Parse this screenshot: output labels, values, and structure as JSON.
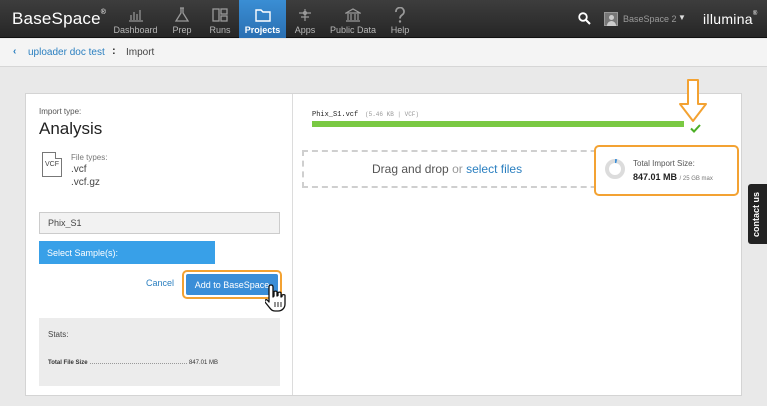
{
  "app": {
    "brand": "BaseSpace",
    "brand_mark": "®",
    "vendor": "illumina",
    "vendor_mark": "®"
  },
  "nav": [
    {
      "label": "Dashboard",
      "icon": "dashboard-icon"
    },
    {
      "label": "Prep",
      "icon": "flask-icon"
    },
    {
      "label": "Runs",
      "icon": "runs-icon"
    },
    {
      "label": "Projects",
      "icon": "folder-icon",
      "active": true
    },
    {
      "label": "Apps",
      "icon": "apps-icon"
    },
    {
      "label": "Public Data",
      "icon": "building-icon"
    },
    {
      "label": "Help",
      "icon": "help-icon"
    }
  ],
  "user": {
    "name": "BaseSpace 2",
    "caret": "▼"
  },
  "breadcrumb": {
    "back": "‹",
    "project": "uploader doc test",
    "separator": ":",
    "current": "Import"
  },
  "import": {
    "type_label": "Import type:",
    "type_value": "Analysis",
    "file_icon_text": "VCF",
    "file_types_label": "File types:",
    "file_types": [
      ".vcf",
      ".vcf.gz"
    ],
    "sample_name": "Phix_S1",
    "select_samples_label": "Select Sample(s):",
    "cancel_label": "Cancel",
    "add_label": "Add to BaseSpace"
  },
  "stats": {
    "label": "Stats:",
    "total_size_label": "Total File Size",
    "total_size_value": "847.01 MB"
  },
  "upload": {
    "file_name": "Phix_S1.vcf",
    "file_meta": "(5.46 KB | VCF)",
    "progress": 1.0,
    "status": "complete"
  },
  "dropzone": {
    "text": "Drag and drop",
    "or": "or",
    "link": "select files"
  },
  "import_size": {
    "label": "Total Import Size:",
    "value": "847.01 MB",
    "max": "/ 25 GB max"
  },
  "contact": "contact us",
  "colors": {
    "accent": "#3a8ed8",
    "progress": "#7ac943",
    "highlight": "#f3a232"
  }
}
